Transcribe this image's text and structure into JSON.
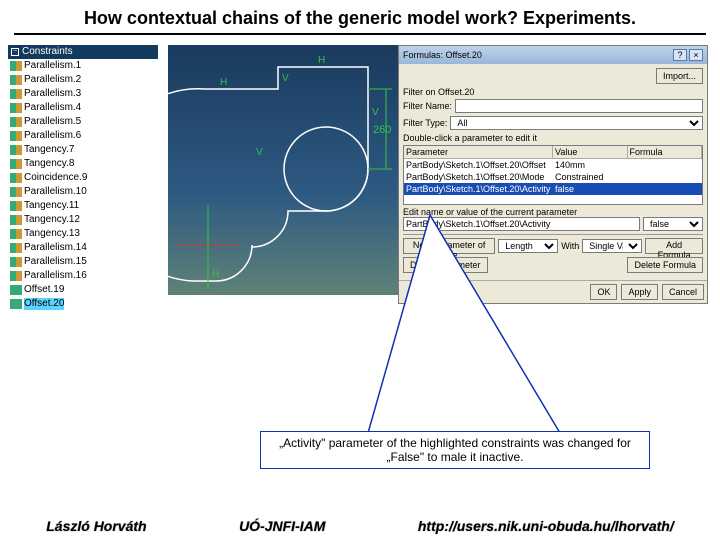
{
  "title": "How contextual chains of the generic model work? Experiments.",
  "tree": {
    "header": "Constraints",
    "items": [
      {
        "label": "Parallelism.1",
        "sel": false
      },
      {
        "label": "Parallelism.2",
        "sel": false
      },
      {
        "label": "Parallelism.3",
        "sel": false
      },
      {
        "label": "Parallelism.4",
        "sel": false
      },
      {
        "label": "Parallelism.5",
        "sel": false
      },
      {
        "label": "Parallelism.6",
        "sel": false
      },
      {
        "label": "Tangency.7",
        "sel": false
      },
      {
        "label": "Tangency.8",
        "sel": false
      },
      {
        "label": "Coincidence.9",
        "sel": false
      },
      {
        "label": "Parallelism.10",
        "sel": false
      },
      {
        "label": "Tangency.11",
        "sel": false
      },
      {
        "label": "Tangency.12",
        "sel": false
      },
      {
        "label": "Tangency.13",
        "sel": false
      },
      {
        "label": "Parallelism.14",
        "sel": false
      },
      {
        "label": "Parallelism.15",
        "sel": false
      },
      {
        "label": "Parallelism.16",
        "sel": false
      },
      {
        "label": "Offset.19",
        "sel": false,
        "kind": "offset"
      },
      {
        "label": "Offset.20",
        "sel": true,
        "kind": "offset"
      }
    ]
  },
  "sketch_label_260": "260",
  "dlg": {
    "title": "Formulas: Offset.20",
    "import": "Import...",
    "filter_on_label": "Filter on Offset.20",
    "filter_name_label": "Filter Name:",
    "filter_name_value": "",
    "filter_type_label": "Filter Type:",
    "filter_type_value": "All",
    "hint": "Double-click a parameter to edit it",
    "cols": {
      "p": "Parameter",
      "v": "Value",
      "f": "Formula"
    },
    "rows": [
      {
        "p": "PartBody\\Sketch.1\\Offset.20\\Offset",
        "v": "140mm",
        "f": ""
      },
      {
        "p": "PartBody\\Sketch.1\\Offset.20\\Mode",
        "v": "Constrained",
        "f": ""
      },
      {
        "p": "PartBody\\Sketch.1\\Offset.20\\Activity",
        "v": "false",
        "f": "",
        "sel": true
      }
    ],
    "edit_label": "Edit name or value of the current parameter",
    "edit_name": "PartBody\\Sketch.1\\Offset.20\\Activity",
    "edit_value": "false",
    "new_param_label": "New Parameter of type",
    "new_param_type": "Length",
    "with_label": "With",
    "with_value": "Single Value",
    "add_formula": "Add Formula",
    "delete_param": "Delete Parameter",
    "delete_formula": "Delete Formula",
    "ok": "OK",
    "apply": "Apply",
    "cancel": "Cancel"
  },
  "callout": "„Activity\" parameter of the highlighted constraints was changed for „False\" to male it inactive.",
  "footer": {
    "author": "László Horváth",
    "org": "UÓ-JNFI-IAM",
    "url": "http://users.nik.uni-obuda.hu/lhorvath/"
  }
}
